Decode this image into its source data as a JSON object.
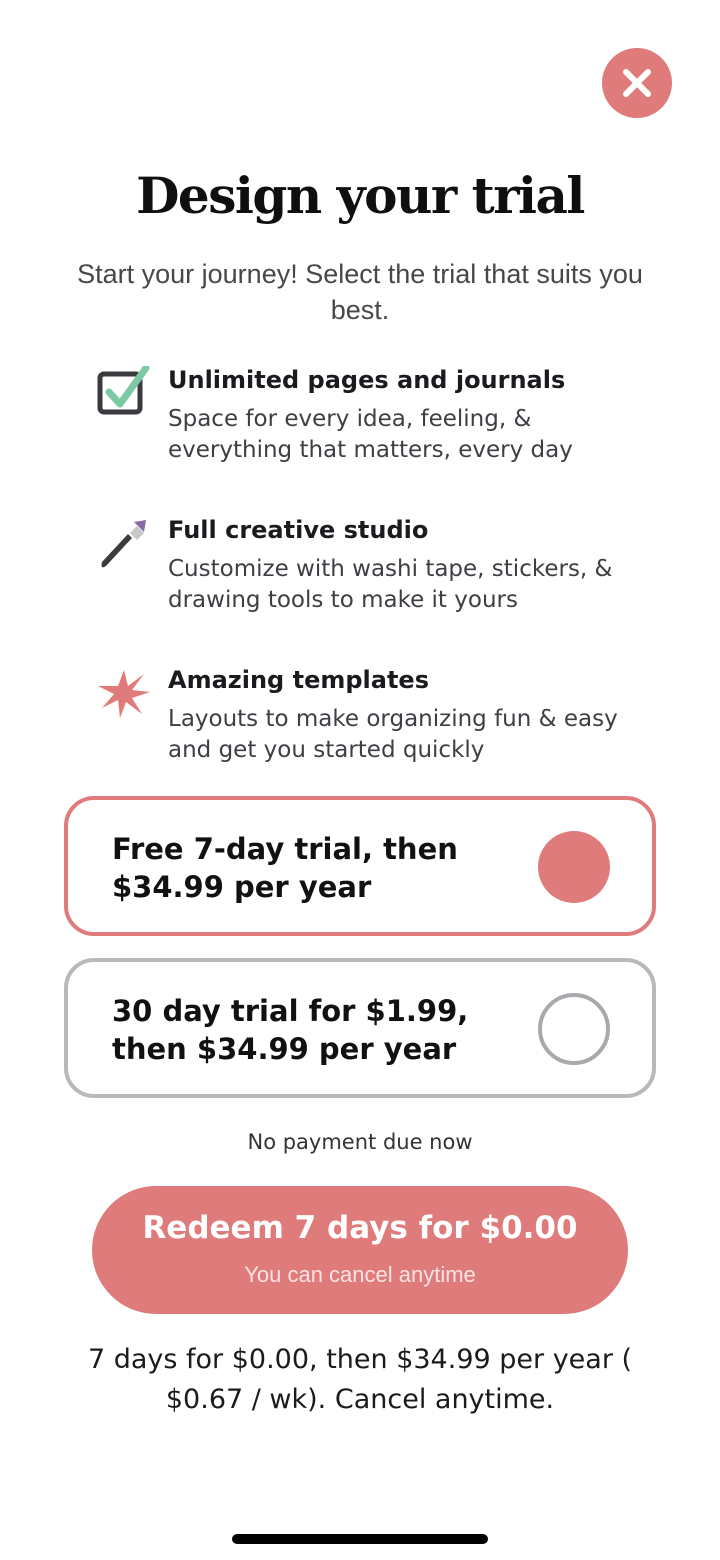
{
  "header": {
    "title": "Design your trial",
    "subtitle": "Start your journey! Select the trial that suits you best."
  },
  "features": [
    {
      "icon": "checkbox-icon",
      "title": "Unlimited pages and journals",
      "description": "Space for every idea, feeling, & everything that matters, every day"
    },
    {
      "icon": "paintbrush-icon",
      "title": "Full creative studio",
      "description": "Customize with washi tape, stickers, & drawing tools to make it yours"
    },
    {
      "icon": "sparkle-icon",
      "title": "Amazing templates",
      "description": "Layouts to make organizing fun & easy and get you started quickly"
    }
  ],
  "plans": [
    {
      "label": "Free 7-day trial, then $34.99 per year",
      "selected": true
    },
    {
      "label": "30 day trial for $1.99, then $34.99 per year",
      "selected": false
    }
  ],
  "payment_note": "No payment due now",
  "cta": {
    "label": "Redeem 7 days for $0.00",
    "sublabel": "You can cancel anytime"
  },
  "terms": "7 days for $0.00, then $34.99 per year ( $0.67 / wk). Cancel anytime.",
  "colors": {
    "accent": "#e07b7b",
    "check_green": "#7dc9a4",
    "brush_purple": "#8c6aa8",
    "dark": "#3a3a3f",
    "border_gray": "#b9b9bc"
  }
}
